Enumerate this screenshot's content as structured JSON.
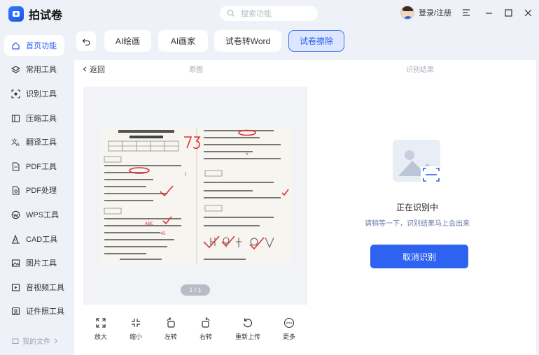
{
  "app": {
    "name": "拍试卷"
  },
  "search": {
    "placeholder": "搜索功能"
  },
  "user": {
    "login_label": "登录/注册"
  },
  "window_controls": {
    "menu_icon": "menu-icon",
    "minimize_icon": "minimize-icon",
    "maximize_icon": "maximize-icon",
    "close_icon": "close-icon"
  },
  "sidebar": {
    "items": [
      {
        "label": "首页功能",
        "icon": "home-icon",
        "active": true
      },
      {
        "label": "常用工具",
        "icon": "layers-icon"
      },
      {
        "label": "识别工具",
        "icon": "scan-icon"
      },
      {
        "label": "压缩工具",
        "icon": "compress-icon"
      },
      {
        "label": "翻译工具",
        "icon": "translate-icon"
      },
      {
        "label": "PDF工具",
        "icon": "pdf-icon"
      },
      {
        "label": "PDF处理",
        "icon": "pdf-process-icon"
      },
      {
        "label": "WPS工具",
        "icon": "wps-icon"
      },
      {
        "label": "CAD工具",
        "icon": "cad-icon"
      },
      {
        "label": "图片工具",
        "icon": "image-icon"
      },
      {
        "label": "音视频工具",
        "icon": "video-icon"
      },
      {
        "label": "证件照工具",
        "icon": "id-photo-icon"
      }
    ],
    "my_files": "我的文件"
  },
  "tabs": [
    {
      "label": "AI绘画",
      "active": false
    },
    {
      "label": "AI画家",
      "active": false
    },
    {
      "label": "试卷转Word",
      "active": false
    },
    {
      "label": "试卷擦除",
      "active": true
    }
  ],
  "panel": {
    "back_label": "返回",
    "original_label": "原图",
    "result_label": "识别结果",
    "page_indicator": "1 / 1"
  },
  "toolbar": [
    {
      "label": "放大",
      "icon": "zoom-in-icon"
    },
    {
      "label": "缩小",
      "icon": "zoom-out-icon"
    },
    {
      "label": "左转",
      "icon": "rotate-left-icon"
    },
    {
      "label": "右转",
      "icon": "rotate-right-icon"
    },
    {
      "label": "重新上传",
      "icon": "reupload-icon"
    },
    {
      "label": "更多",
      "icon": "more-icon"
    }
  ],
  "status": {
    "title": "正在识别中",
    "subtitle": "请稍等一下，识别结果马上会出来",
    "cancel_label": "取消识别"
  },
  "colors": {
    "accent": "#2d63f0",
    "active_tab_bg": "#dce6ff",
    "app_bg": "#eef1f8"
  }
}
